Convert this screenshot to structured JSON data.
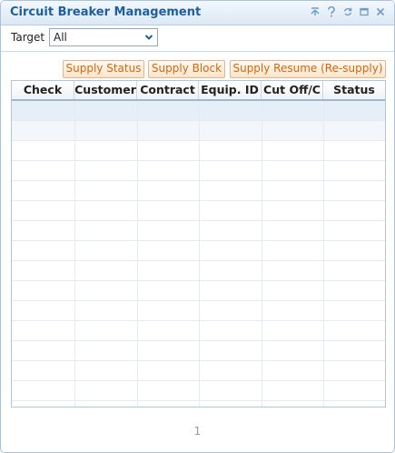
{
  "window": {
    "title": "Circuit Breaker Management"
  },
  "titlebar_icons": [
    "collapse-icon",
    "help-icon",
    "refresh-icon",
    "maximize-icon",
    "close-icon"
  ],
  "filter": {
    "label": "Target",
    "value": "All"
  },
  "buttons": {
    "supply_status": "Supply Status",
    "supply_block": "Supply Block",
    "supply_resume": "Supply Resume (Re-supply)"
  },
  "table": {
    "columns": [
      "Check",
      "Customer",
      "Contract",
      "Equip. ID",
      "Cut Off/C",
      "Status"
    ],
    "rows": []
  },
  "pagination": {
    "current": "1"
  },
  "colors": {
    "title": "#1c5f9e",
    "button_text": "#d4660f",
    "button_border": "#e3b58a",
    "border": "#a9c3da"
  }
}
